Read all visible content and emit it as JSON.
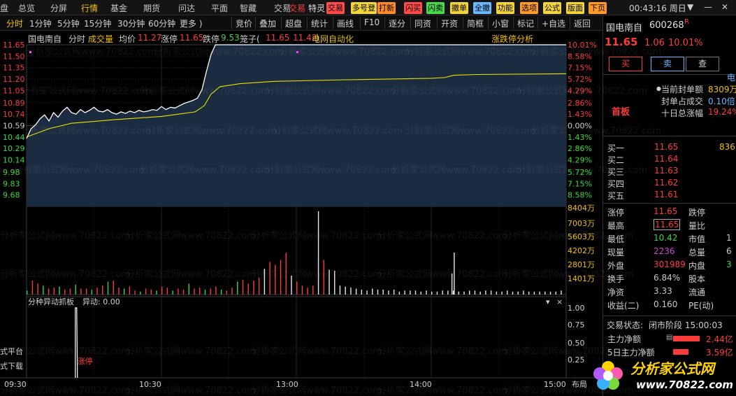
{
  "menu": [
    "盘",
    "总览",
    "分屏",
    "行情",
    "基金",
    "期货",
    "问达",
    "平面",
    "智藏",
    "交易"
  ],
  "menu_active": "行情",
  "menu_red": "交易",
  "special": "特灵",
  "quick_buttons": [
    {
      "label": "交易",
      "color": "#ff4a4a"
    },
    {
      "label": "多号登",
      "color": "#f2d33a"
    },
    {
      "label": "打新",
      "color": "#ff8a2a"
    },
    {
      "label": "闪买",
      "color": "#ff4a4a"
    },
    {
      "label": "闪卖",
      "color": "#4ad84a"
    },
    {
      "label": "撤单",
      "color": "#f2d33a"
    },
    {
      "label": "全撤",
      "color": "#6ab8ff"
    },
    {
      "label": "功能",
      "color": "#f2d33a"
    },
    {
      "label": "选项",
      "color": "#ff9a2a"
    },
    {
      "label": "公式",
      "color": "#f2d33a"
    },
    {
      "label": "版面",
      "color": "#f2d33a"
    },
    {
      "label": "下页",
      "color": "#ff9a2a"
    }
  ],
  "clock": "00:43:16 周日",
  "toolbar": [
    "分时",
    "1分钟",
    "5分钟",
    "15分钟",
    "30分钟",
    "60分钟",
    "更多 )",
    "竞价",
    "叠加",
    "超盘",
    "统计",
    "画线",
    "F10",
    "逐分",
    "同资",
    "开资",
    "简框",
    "小窗",
    "标记",
    "+自选",
    "返回"
  ],
  "info": {
    "name": "国电南自",
    "mode": "分时",
    "vol_label": "成交量",
    "avg_label": "均价",
    "avg": "11.27",
    "zt_label": "涨停",
    "zt": "11.65",
    "dt_label": "跌停",
    "dt": "9.53",
    "cage_label": "笼子(",
    "cage_hi": "11.65",
    "cage_lo": "11.42",
    ")": ")",
    "concept": "电网自动化",
    "zt_analysis": "涨跌停分析"
  },
  "price_labels": [
    "11.65",
    "11.50",
    "11.35",
    "11.20",
    "11.05",
    "10.89",
    "10.74",
    "10.59",
    "10.44",
    "10.29",
    "10.14",
    "9.98",
    "9.83",
    "9.68"
  ],
  "pct_labels": [
    "10.01%",
    "8.58%",
    "7.15%",
    "5.72%",
    "4.29%",
    "2.86%",
    "1.43%",
    "0.00%",
    "1.43%",
    "2.86%",
    "4.29%",
    "5.72%",
    "7.15%",
    "8.58%"
  ],
  "vol_labels": [
    "8404万",
    "7003万",
    "5603万",
    "4202万",
    "2801万",
    "1401万"
  ],
  "ind_header": {
    "title": "分种异动抓板",
    "sub": "异动: 0.00"
  },
  "ind_labels": [
    "1.00",
    "0.75",
    "0.50",
    "0.25"
  ],
  "ind_marker": "涨停",
  "left_partial": [
    "式平台",
    "式下载"
  ],
  "time_labels": [
    "09:30",
    "10:30",
    "13:00",
    "14:00",
    "15:00"
  ],
  "layout_btn": "布局",
  "chart_data": {
    "type": "line",
    "prev_close": 10.59,
    "y_range": [
      9.53,
      11.65
    ],
    "x": [
      "09:30",
      "10:30",
      "11:30/13:00",
      "14:00",
      "15:00"
    ],
    "price": [
      [
        0,
        10.42
      ],
      [
        2,
        10.55
      ],
      [
        4,
        10.6
      ],
      [
        6,
        10.68
      ],
      [
        8,
        10.73
      ],
      [
        10,
        10.65
      ],
      [
        12,
        10.76
      ],
      [
        14,
        10.7
      ],
      [
        16,
        10.78
      ],
      [
        18,
        10.83
      ],
      [
        20,
        10.76
      ],
      [
        22,
        10.74
      ],
      [
        24,
        10.8
      ],
      [
        26,
        10.76
      ],
      [
        28,
        10.79
      ],
      [
        30,
        10.83
      ],
      [
        32,
        10.78
      ],
      [
        34,
        10.77
      ],
      [
        36,
        10.8
      ],
      [
        38,
        10.76
      ],
      [
        40,
        10.74
      ],
      [
        42,
        10.77
      ],
      [
        44,
        10.75
      ],
      [
        46,
        10.78
      ],
      [
        48,
        10.76
      ],
      [
        50,
        10.79
      ],
      [
        52,
        10.77
      ],
      [
        54,
        10.78
      ],
      [
        56,
        10.8
      ],
      [
        58,
        10.79
      ],
      [
        60,
        10.84
      ],
      [
        62,
        10.8
      ],
      [
        64,
        10.83
      ],
      [
        66,
        10.82
      ],
      [
        68,
        10.85
      ],
      [
        70,
        10.88
      ],
      [
        72,
        10.9
      ],
      [
        74,
        10.92
      ],
      [
        76,
        10.95
      ],
      [
        78,
        11.06
      ],
      [
        80,
        11.3
      ],
      [
        82,
        11.52
      ],
      [
        84,
        11.65
      ],
      [
        240,
        11.65
      ]
    ],
    "avg_price": [
      [
        0,
        10.44
      ],
      [
        10,
        10.55
      ],
      [
        20,
        10.62
      ],
      [
        40,
        10.67
      ],
      [
        60,
        10.71
      ],
      [
        75,
        10.77
      ],
      [
        79,
        10.85
      ],
      [
        82,
        11.0
      ],
      [
        86,
        11.1
      ],
      [
        95,
        11.14
      ],
      [
        110,
        11.17
      ],
      [
        140,
        11.19
      ],
      [
        180,
        11.21
      ],
      [
        186,
        11.22
      ],
      [
        190,
        11.25
      ],
      [
        200,
        11.26
      ],
      [
        240,
        11.27
      ]
    ],
    "volume_wan": [
      400,
      1400,
      1100,
      900,
      600,
      700,
      800,
      500,
      600,
      1000,
      600,
      600,
      500,
      700,
      900,
      1300,
      1400,
      700,
      600,
      800,
      400,
      300,
      600,
      500,
      400,
      800,
      700,
      400,
      600,
      500,
      1100,
      600,
      700,
      500,
      600,
      800,
      500,
      400,
      700,
      1300,
      1500,
      1100,
      1400,
      1700,
      2600,
      3300,
      3000,
      3500,
      4200,
      1900,
      1300,
      900,
      700,
      900,
      8404,
      3500,
      2500,
      2400,
      900,
      800,
      700,
      600,
      500,
      400,
      600,
      500,
      500,
      400,
      500,
      300,
      400,
      400,
      400,
      300,
      400,
      300,
      300,
      400,
      400,
      400,
      300,
      300,
      400,
      400,
      300,
      400,
      400,
      300,
      300,
      400,
      300,
      300,
      400,
      300,
      300,
      300,
      300,
      300,
      300,
      400
    ],
    "ind_spike_min": 22,
    "ind_spike_val": 1.0
  },
  "right": {
    "name": "国电南自",
    "code": "600268",
    "r": "R",
    "price": "11.65",
    "chg": "1.06",
    "pct": "10.01%",
    "buy": "买",
    "sell": "卖",
    "check": "查",
    "banner": "首板",
    "seal": [
      {
        "l": "当前封单额",
        "v": "8309万",
        "c": "#f0c000"
      },
      {
        "l": "封单占成交",
        "v": "0.10倍",
        "c": "#6ab8ff"
      },
      {
        "l": "十日总涨幅",
        "v": "19.24%",
        "c": "#ff3a3a"
      }
    ],
    "bids": [
      {
        "l": "买一",
        "p": "11.65",
        "v": "836"
      },
      {
        "l": "买二",
        "p": "11.64",
        "v": ""
      },
      {
        "l": "买三",
        "p": "11.63",
        "v": ""
      },
      {
        "l": "买四",
        "p": "11.62",
        "v": ""
      },
      {
        "l": "买五",
        "p": "11.61",
        "v": ""
      }
    ],
    "stats": [
      [
        {
          "l": "涨停",
          "v": "11.65",
          "c": "#ff3a3a"
        },
        {
          "l": "跌停",
          "v": "",
          "c": "#3ad83a"
        }
      ],
      [
        {
          "l": "最高",
          "v": "11.65",
          "c": "#ff3a3a",
          "box": true
        },
        {
          "l": "量比",
          "v": "",
          "c": "#c8c8c8"
        }
      ],
      [
        {
          "l": "最低",
          "v": "10.42",
          "c": "#3ad83a"
        },
        {
          "l": "市值",
          "v": "1",
          "c": "#c8c8c8"
        }
      ],
      [
        {
          "l": "现量",
          "v": "2236",
          "c": "#d040d0"
        },
        {
          "l": "总量",
          "v": "6",
          "c": "#c8c8c8"
        }
      ],
      [
        {
          "l": "外盘",
          "v": "301989",
          "c": "#ff3a3a"
        },
        {
          "l": "内盘",
          "v": "3",
          "c": "#3ad83a"
        }
      ],
      [
        {
          "l": "换手",
          "v": "6.84%",
          "c": "#c8c8c8"
        },
        {
          "l": "股本",
          "v": "",
          "c": "#c8c8c8"
        }
      ],
      [
        {
          "l": "净资",
          "v": "3.33",
          "c": "#c8c8c8"
        },
        {
          "l": "流通",
          "v": "",
          "c": "#c8c8c8"
        }
      ],
      [
        {
          "l": "收益(二)",
          "v": "0.160",
          "c": "#c8c8c8"
        },
        {
          "l": "PE(动)",
          "v": "",
          "c": "#c8c8c8"
        }
      ]
    ],
    "status_label": "交易状态:",
    "status": "闭市阶段 15:00:03",
    "flows": [
      {
        "l": "主力净额",
        "v": "2.44亿"
      },
      {
        "l": "5日主力净额",
        "v": "3.59亿"
      }
    ],
    "partial_e": "电"
  },
  "watermark": "分析家公式网www.70822.com",
  "logo": {
    "title": "分析家公式网",
    "url": "www.70822.com"
  }
}
